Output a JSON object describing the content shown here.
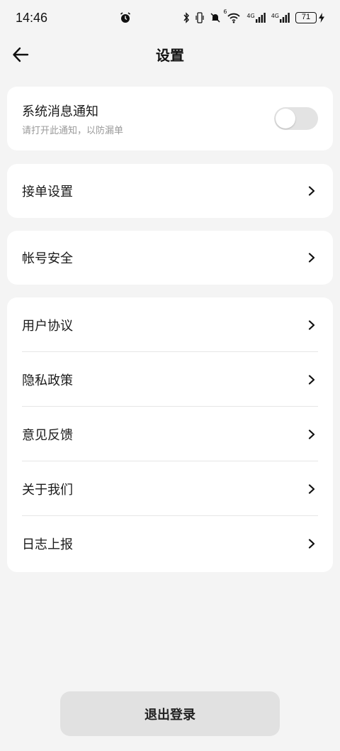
{
  "status_bar": {
    "time": "14:46",
    "battery_level": "71",
    "icons": [
      "alarm-icon",
      "bluetooth-icon",
      "vibrate-icon",
      "mute-icon",
      "wifi-icon",
      "signal-4g-icon",
      "signal-4g-icon",
      "battery-icon",
      "charging-icon"
    ],
    "network_label_1": "4G",
    "network_label_2": "4G",
    "wifi_label": "6"
  },
  "header": {
    "title": "设置",
    "back_icon": "arrow-left-icon"
  },
  "notification": {
    "title": "系统消息通知",
    "subtitle": "请打开此通知，以防漏单",
    "enabled": false
  },
  "menu_groups": [
    {
      "items": [
        {
          "label": "接单设置"
        }
      ]
    },
    {
      "items": [
        {
          "label": "帐号安全"
        }
      ]
    },
    {
      "items": [
        {
          "label": "用户协议"
        },
        {
          "label": "隐私政策"
        },
        {
          "label": "意见反馈"
        },
        {
          "label": "关于我们"
        },
        {
          "label": "日志上报"
        }
      ]
    }
  ],
  "logout": {
    "label": "退出登录"
  },
  "colors": {
    "background": "#f4f4f4",
    "card": "#ffffff",
    "toggle_off": "#e3e3e3",
    "logout_button": "#e1e1e1"
  }
}
